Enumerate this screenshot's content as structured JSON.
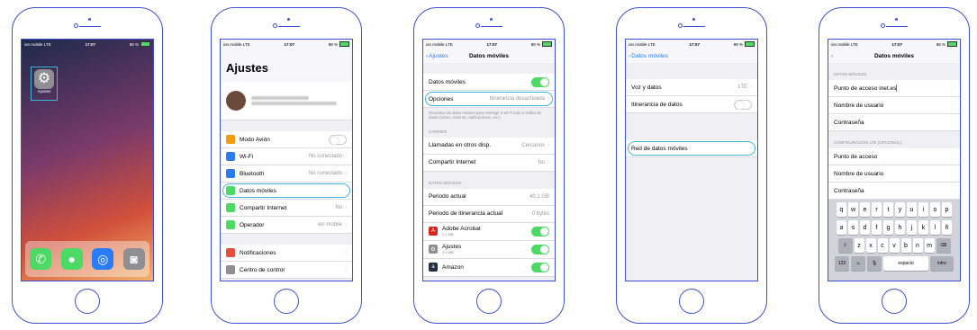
{
  "status": {
    "carrier": "ion mobile",
    "network": "LTE",
    "time": "17:07",
    "battery": "88 %"
  },
  "screen1": {
    "app_label": "Ajustes"
  },
  "screen2": {
    "title": "Ajustes",
    "items": [
      {
        "label": "Modo Avión",
        "value": "",
        "color": "#f39c12"
      },
      {
        "label": "Wi-Fi",
        "value": "No conectado",
        "color": "#2a7cf6"
      },
      {
        "label": "Bluetooth",
        "value": "No conectado",
        "color": "#2a7cf6"
      },
      {
        "label": "Datos móviles",
        "value": "",
        "color": "#4cd964"
      },
      {
        "label": "Compartir Internet",
        "value": "No",
        "color": "#4cd964"
      },
      {
        "label": "Operador",
        "value": "ion mobile",
        "color": "#4cd964"
      },
      {
        "label": "Notificaciones",
        "value": "",
        "color": "#e74c3c"
      },
      {
        "label": "Centro de control",
        "value": "",
        "color": "#8e8e93"
      }
    ]
  },
  "screen3": {
    "back": "Ajustes",
    "title": "Datos móviles",
    "datos_label": "Datos móviles",
    "opciones_label": "Opciones",
    "opciones_value": "Itinerancia desactivada",
    "note": "Desactiva los datos móviles para restringir a Wi-Fi todo el tráfico de datos (correo, Internet, notificaciones, etc.).",
    "carrier_header": "CARRIER",
    "llamadas_label": "Llamadas en otros disp.",
    "llamadas_value": "Cercanos",
    "compartir_label": "Compartir Internet",
    "compartir_value": "No",
    "datos_header": "DATOS MÓVILES",
    "periodo_label": "Periodo actual",
    "periodo_value": "40,1 GB",
    "itin_label": "Periodo de itinerancia actual",
    "itin_value": "0 bytes",
    "apps": [
      {
        "name": "Adobe Acrobat",
        "size": "2,1 MB"
      },
      {
        "name": "Ajustes",
        "size": "2,5 MB"
      },
      {
        "name": "Amazon",
        "size": ""
      }
    ]
  },
  "screen4": {
    "back": "Datos móviles",
    "voz_label": "Voz y datos",
    "voz_value": "LTE",
    "itin_label": "Itinerancia de datos",
    "red_label": "Red de datos móviles"
  },
  "screen5": {
    "title": "Datos móviles",
    "header1": "DATOS MÓVILES",
    "punto_label": "Punto de acceso",
    "punto_value": "inet.es",
    "usuario_label": "Nombre de usuario",
    "pass_label": "Contraseña",
    "header2": "CONFIGURACIÓN LTE (OPCIONAL)",
    "punto2_label": "Punto de acceso",
    "usuario2_label": "Nombre de usuario",
    "pass2_label": "Contraseña",
    "kb_row1": [
      "q",
      "w",
      "e",
      "r",
      "t",
      "y",
      "u",
      "i",
      "o",
      "p"
    ],
    "kb_row2": [
      "a",
      "s",
      "d",
      "f",
      "g",
      "h",
      "j",
      "k",
      "l",
      "ñ"
    ],
    "kb_row3": [
      "z",
      "x",
      "c",
      "v",
      "b",
      "n",
      "m"
    ],
    "kb_num": "123",
    "kb_space": "espacio",
    "kb_enter": "intro"
  }
}
